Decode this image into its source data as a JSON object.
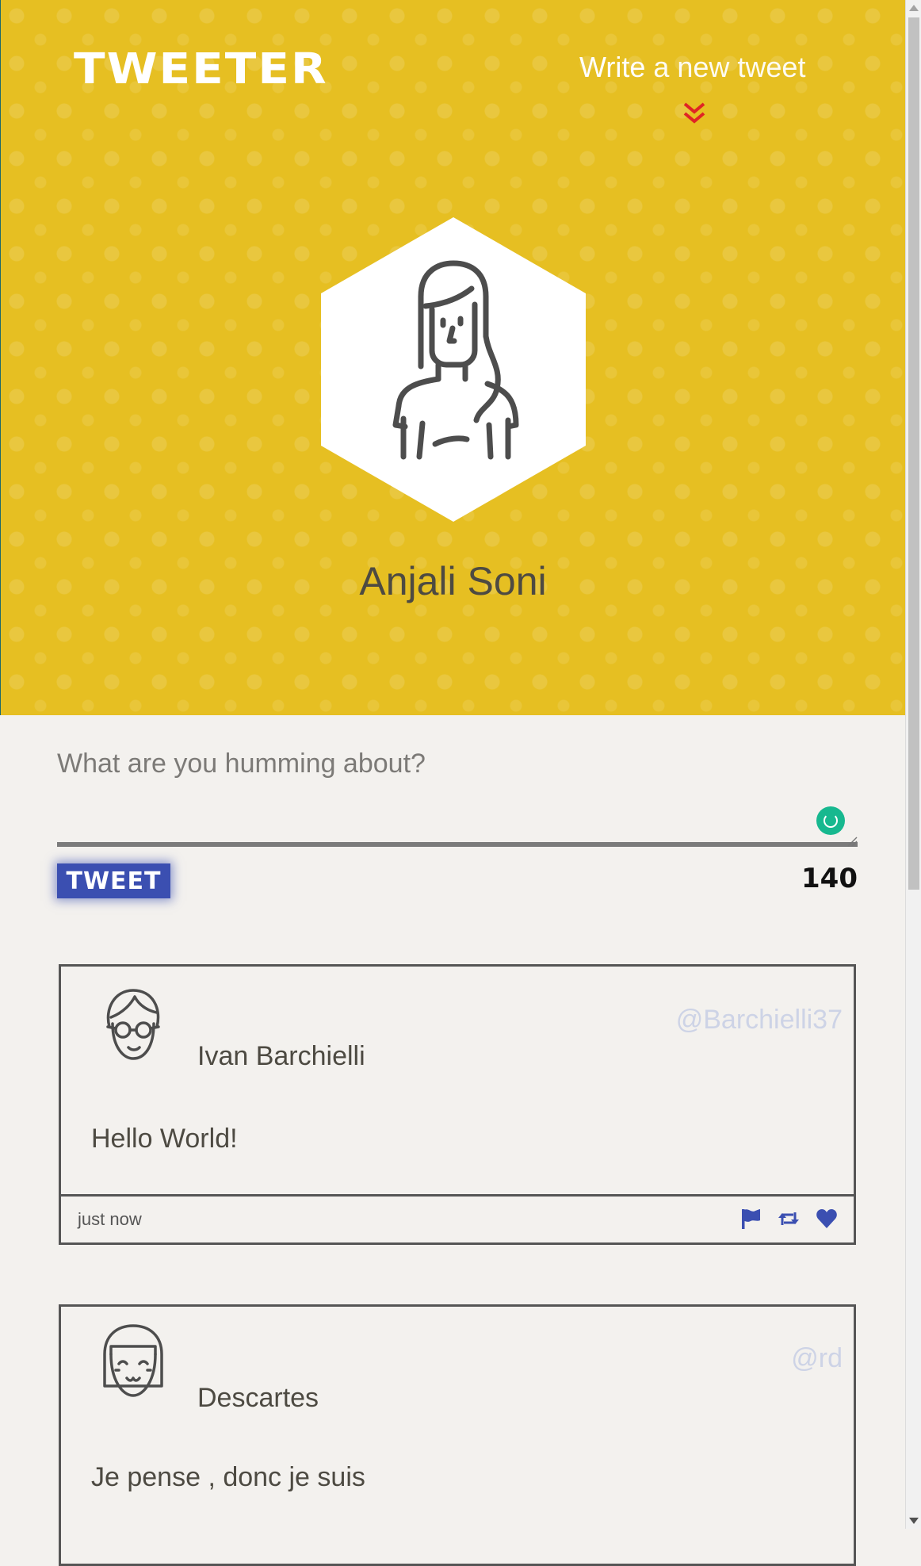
{
  "header": {
    "logo": "TWEETER",
    "write_strong": "Write",
    "write_rest": " a new tweet",
    "profile_name": "Anjali Soni"
  },
  "compose": {
    "placeholder": "What are you humming about?",
    "value": "",
    "tweet_button": "TWEET",
    "char_count": "140"
  },
  "tweets": [
    {
      "avatar": "man-with-glasses-avatar",
      "name": "Ivan Barchielli",
      "handle": "@Barchielli37",
      "text": "Hello World!",
      "time": "just now"
    },
    {
      "avatar": "woman-with-bangs-avatar",
      "name": "Descartes",
      "handle": "@rd",
      "text": "Je pense , donc je suis",
      "time": ""
    }
  ],
  "colors": {
    "header_bg": "#e6bf22",
    "accent_blue": "#3b4fb1",
    "chevron_red": "#e02424",
    "page_bg": "#f3f1ee"
  },
  "icons": {
    "write_toggle": "double-chevron-down-icon",
    "flag": "flag-icon",
    "retweet": "retweet-icon",
    "like": "heart-icon"
  }
}
